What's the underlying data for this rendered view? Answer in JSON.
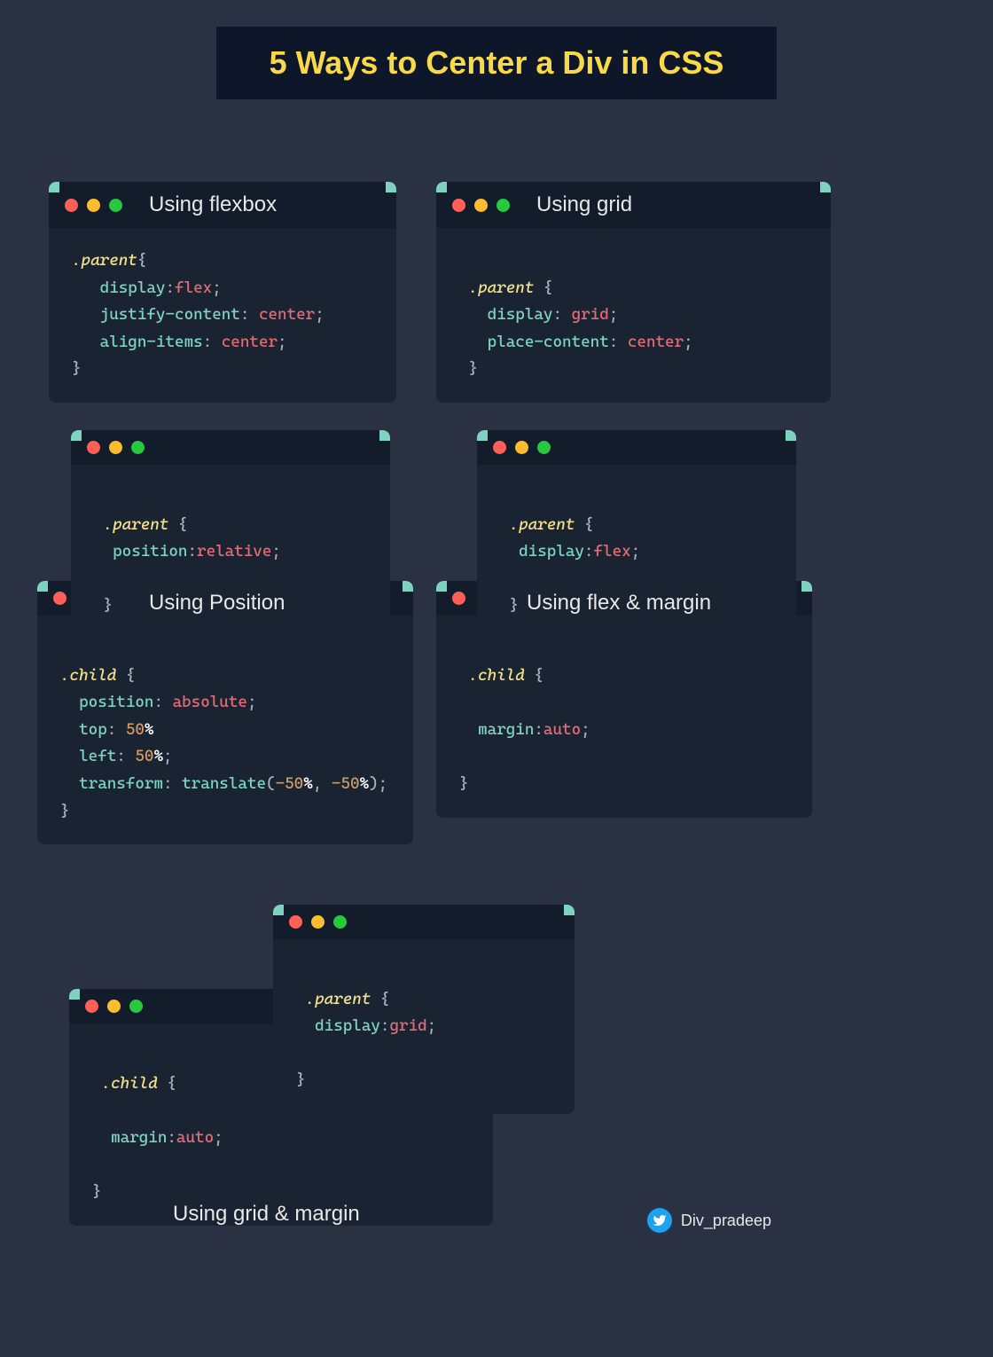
{
  "title": "5  Ways to Center a Div in CSS",
  "windows": {
    "flexbox": {
      "title": "Using flexbox",
      "selector": ".parent",
      "props": [
        {
          "prop": "display",
          "val": "flex"
        },
        {
          "prop": "justify-content",
          "val": "center"
        },
        {
          "prop": "align-items",
          "val": "center"
        }
      ]
    },
    "grid": {
      "title": "Using grid",
      "selector": ".parent",
      "props": [
        {
          "prop": "display",
          "val": "grid"
        },
        {
          "prop": "place-content",
          "val": "center"
        }
      ]
    },
    "position": {
      "title": "Using Position",
      "parent": {
        "selector": ".parent",
        "props": [
          {
            "prop": "position",
            "val": "relative"
          }
        ]
      },
      "child": {
        "selector": ".child",
        "props": [
          {
            "prop": "position",
            "val": "absolute"
          },
          {
            "prop": "top",
            "val": "50%",
            "nosemi": true
          },
          {
            "prop": "left",
            "val": "50%"
          },
          {
            "prop": "transform",
            "func": "translate",
            "args": [
              "-50%",
              "-50%"
            ]
          }
        ]
      }
    },
    "flexmargin": {
      "title": "Using flex & margin",
      "parent": {
        "selector": ".parent",
        "props": [
          {
            "prop": "display",
            "val": "flex"
          }
        ]
      },
      "child": {
        "selector": ".child",
        "props": [
          {
            "prop": "margin",
            "val": "auto"
          }
        ]
      }
    },
    "gridmargin": {
      "title": "Using grid & margin",
      "parent": {
        "selector": ".parent",
        "props": [
          {
            "prop": "display",
            "val": "grid"
          }
        ]
      },
      "child": {
        "selector": ".child",
        "props": [
          {
            "prop": "margin",
            "val": "auto"
          }
        ]
      }
    }
  },
  "footer": {
    "handle": "Div_pradeep"
  }
}
